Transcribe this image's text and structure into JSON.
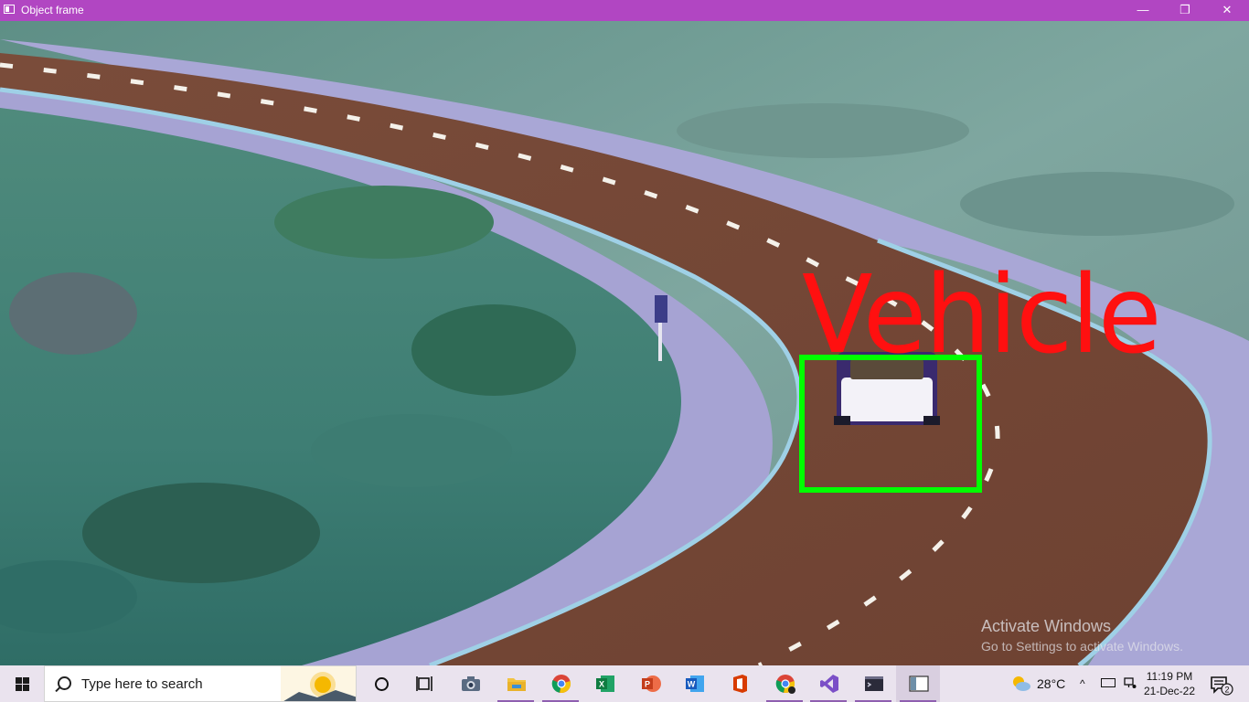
{
  "window": {
    "title": "Object frame",
    "min_glyph": "—",
    "max_glyph": "❐",
    "close_glyph": "✕"
  },
  "detection": {
    "label": "Vehicle",
    "box_color": "#00ff00",
    "label_color": "#ff1010"
  },
  "watermark": {
    "title": "Activate Windows",
    "subtitle": "Go to Settings to activate Windows."
  },
  "taskbar": {
    "search_placeholder": "Type here to search",
    "apps": [
      {
        "name": "cortana",
        "icon": "circle-icon"
      },
      {
        "name": "task-view",
        "icon": "task-view-icon"
      },
      {
        "name": "camera",
        "icon": "camera-icon"
      },
      {
        "name": "file-explorer",
        "icon": "folder-icon"
      },
      {
        "name": "chrome",
        "icon": "chrome-icon"
      },
      {
        "name": "excel",
        "icon": "excel-icon"
      },
      {
        "name": "powerpoint",
        "icon": "powerpoint-icon"
      },
      {
        "name": "word",
        "icon": "word-icon"
      },
      {
        "name": "office",
        "icon": "office-icon"
      },
      {
        "name": "chrome-profile",
        "icon": "chrome-icon"
      },
      {
        "name": "visual-studio",
        "icon": "visual-studio-icon"
      },
      {
        "name": "terminal",
        "icon": "terminal-icon"
      },
      {
        "name": "object-frame",
        "icon": "window-icon"
      }
    ],
    "weather_temp": "28°C",
    "tray_chevron": "^",
    "clock_time": "11:19 PM",
    "clock_date": "21-Dec-22",
    "notification_count": "2"
  }
}
